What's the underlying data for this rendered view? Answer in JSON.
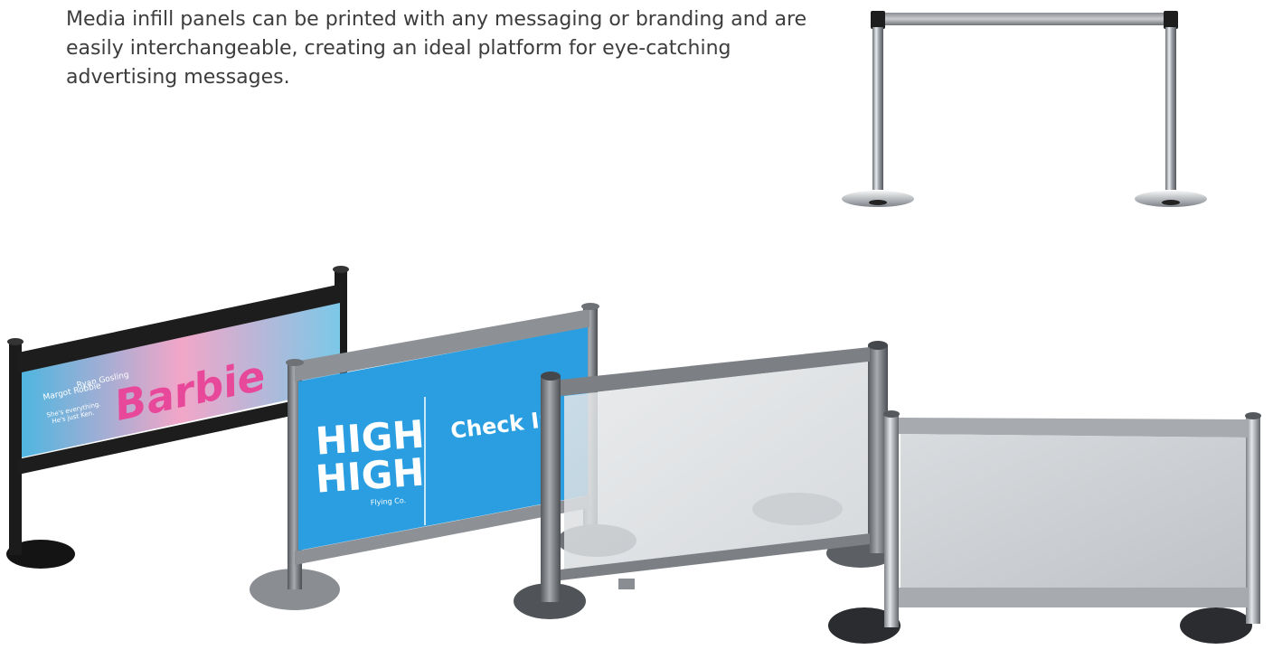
{
  "description": "Media infill panels can be printed with any messaging or branding and are easily interchangeable, creating an ideal platform for eye-catching advertising messages.",
  "panels": {
    "barbie": {
      "brand": "Barbie",
      "actor1": "Margot Robbie",
      "actor2": "Ryan Gosling",
      "tagline1": "She's everything.",
      "tagline2": "He's just Ken."
    },
    "blue": {
      "logo_line1": "HIGH",
      "logo_line2": "HIGH",
      "logo_sub": "Flying Co.",
      "label": "Check In"
    }
  },
  "colors": {
    "text": "#3d3d3d",
    "blue_panel": "#2a9ee0",
    "barbie_pink": "#e8489a",
    "post_black": "#1b1b1b",
    "post_silver": "#b8bcc0"
  }
}
